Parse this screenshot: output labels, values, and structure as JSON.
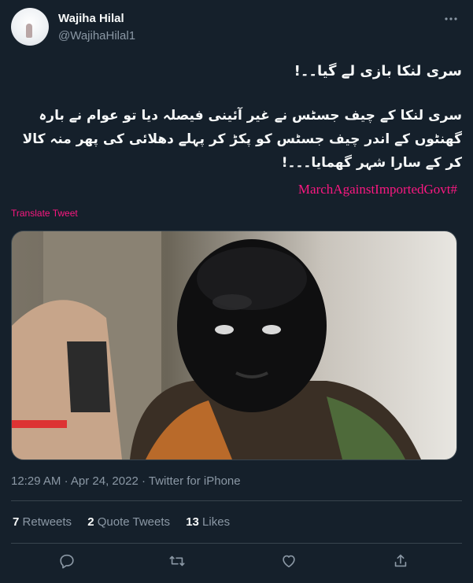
{
  "user": {
    "name": "Wajiha Hilal",
    "handle": "@WajihaHilal1"
  },
  "tweet": {
    "line1": "سری لنکا بازی لے گیا۔۔!",
    "line2": "سری لنکا کے چیف جسٹس نے غیر آئینی فیصلہ دیا تو عوام نے بارہ گھنٹوں کے اندر چیف جسٹس کو پکڑ کر پہلے دھلائی کی پھر منہ کالا کر کے سارا شہر گھمایا۔۔۔!",
    "hashtag": "MarchAgainstImportedGovt#",
    "translate_label": "Translate Tweet"
  },
  "meta": {
    "time": "12:29 AM",
    "date": "Apr 24, 2022",
    "separator": "·",
    "source": "Twitter for iPhone"
  },
  "stats": {
    "retweets_count": "7",
    "retweets_label": "Retweets",
    "quotes_count": "2",
    "quotes_label": "Quote Tweets",
    "likes_count": "13",
    "likes_label": "Likes"
  },
  "icons": {
    "more": "more-horizontal-icon",
    "reply": "reply-icon",
    "retweet": "retweet-icon",
    "like": "heart-icon",
    "share": "share-icon"
  },
  "colors": {
    "background": "#15202b",
    "text": "#f7f9f9",
    "secondary": "#8b98a5",
    "accent_pink": "#f91880",
    "border": "#38444d"
  }
}
